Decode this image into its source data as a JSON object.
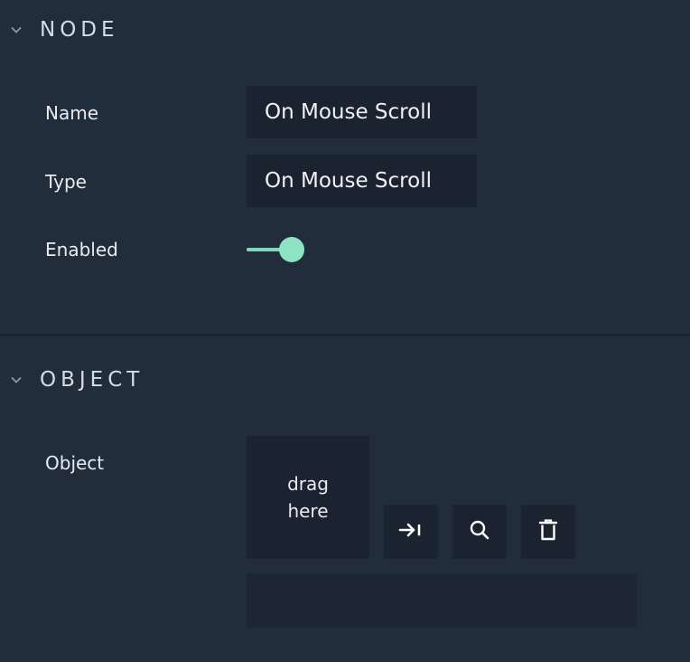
{
  "node_section": {
    "title": "NODE",
    "name_label": "Name",
    "name_value": "On Mouse Scroll",
    "type_label": "Type",
    "type_value": "On Mouse Scroll",
    "enabled_label": "Enabled",
    "enabled": true
  },
  "object_section": {
    "title": "OBJECT",
    "object_label": "Object",
    "drop_line1": "drag",
    "drop_line2": "here",
    "buttons": [
      "select-target-icon",
      "search-icon",
      "trash-icon"
    ],
    "path_value": ""
  },
  "colors": {
    "background": "#222d3c",
    "field": "#1b2230",
    "accent": "#8ee3c2"
  }
}
